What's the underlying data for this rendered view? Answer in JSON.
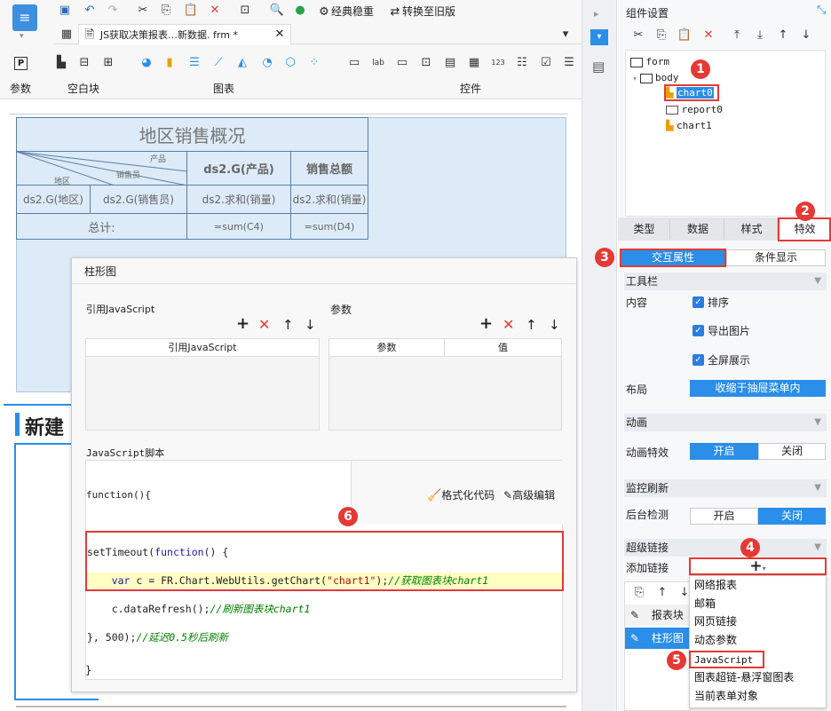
{
  "toolbar": {
    "classic_label": "经典稳重",
    "switch_label": "转换至旧版"
  },
  "tab": {
    "title": "JS获取决策报表…新数据. frm *"
  },
  "ribbon": {
    "param_group": "参数",
    "blank_group": "空白块",
    "chart_group": "图表",
    "control_group": "控件"
  },
  "report": {
    "title": "地区销售概况",
    "diag_product": "产品",
    "diag_salesman": "销售员",
    "diag_region": "地区",
    "col_product": "ds2.G(产品)",
    "col_total": "销售总额",
    "cell_region": "ds2.G(地区)",
    "cell_salesman": "ds2.G(销售员)",
    "cell_sum1": "ds2.求和(销量)",
    "cell_sum2": "ds2.求和(销量)",
    "total_label": "总计:",
    "total_c4": "=sum(C4)",
    "total_d4": "=sum(D4)",
    "new_label": "新建"
  },
  "dialog": {
    "title": "柱形图",
    "ref_js_label": "引用JavaScript",
    "ref_js_col": "引用JavaScript",
    "params_label": "参数",
    "param_col": "参数",
    "value_col": "值",
    "script_label": "JavaScript脚本",
    "func_open": "function(){",
    "format_code": "格式化代码",
    "advanced_edit": "高级编辑",
    "code_line1_a": "setTimeout(",
    "code_line1_b": "function",
    "code_line1_c": "() {",
    "code_line2_a": "    var",
    "code_line2_b": " c = FR.Chart.WebUtils.getChart(",
    "code_line2_c": "\"chart1\"",
    "code_line2_d": ");",
    "code_line2_e": "//获取图表块chart1",
    "code_line3_a": "    c.dataRefresh();",
    "code_line3_b": "//刷新图表块chart1",
    "code_line4_a": "}, 500);",
    "code_line4_b": "//延迟0.5秒后刷新",
    "func_close": "}"
  },
  "right_panel": {
    "title": "组件设置",
    "tree": {
      "form": "form",
      "body": "body",
      "chart0": "chart0",
      "report0": "report0",
      "chart1": "chart1"
    },
    "tabs": [
      "类型",
      "数据",
      "样式",
      "特效"
    ],
    "sub_tabs": [
      "交互属性",
      "条件显示"
    ],
    "toolbar_section": "工具栏",
    "content_label": "内容",
    "check_sort": "排序",
    "check_export": "导出图片",
    "check_fullscreen": "全屏展示",
    "layout_label": "布局",
    "layout_value": "收缩于抽屉菜单内",
    "animation_section": "动画",
    "animation_effect": "动画特效",
    "anim_on": "开启",
    "anim_off": "关闭",
    "monitor_section": "监控刷新",
    "backend_check": "后台检测",
    "mon_on": "开启",
    "mon_off": "关闭",
    "hyperlink_section": "超级链接",
    "add_link": "添加链接",
    "link_rows": [
      "报表块",
      "柱形图"
    ],
    "menu": [
      "网络报表",
      "邮箱",
      "网页链接",
      "动态参数",
      "JavaScript",
      "图表超链-悬浮窗图表",
      "当前表单对象"
    ]
  },
  "badges": [
    "1",
    "2",
    "3",
    "4",
    "5",
    "6"
  ],
  "colors": {
    "accent": "#2b8ee8",
    "badge": "#e53935",
    "canvas_bg": "#dcebf7"
  }
}
